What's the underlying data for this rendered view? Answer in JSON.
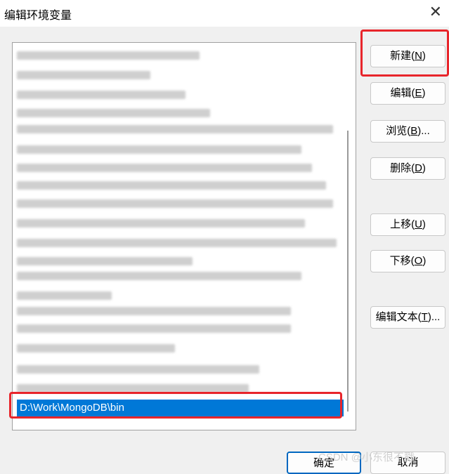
{
  "window": {
    "title": "编辑环境变量",
    "close_glyph": "✕"
  },
  "list": {
    "selected_item": "D:\\Work\\MongoDB\\bin"
  },
  "buttons": {
    "new": {
      "label": "新建(",
      "key": "N",
      "suffix": ")"
    },
    "edit": {
      "label": "编辑(",
      "key": "E",
      "suffix": ")"
    },
    "browse": {
      "label": "浏览(",
      "key": "B",
      "suffix": ")..."
    },
    "delete": {
      "label": "删除(",
      "key": "D",
      "suffix": ")"
    },
    "move_up": {
      "label": "上移(",
      "key": "U",
      "suffix": ")"
    },
    "move_down": {
      "label": "下移(",
      "key": "O",
      "suffix": ")"
    },
    "edit_text": {
      "label": "编辑文本(",
      "key": "T",
      "suffix": ")..."
    }
  },
  "footer": {
    "ok": "确定",
    "cancel": "取消",
    "watermark": "CSDN @小东很不戳"
  },
  "colors": {
    "selection": "#0078d7",
    "highlight": "#e8252b"
  }
}
